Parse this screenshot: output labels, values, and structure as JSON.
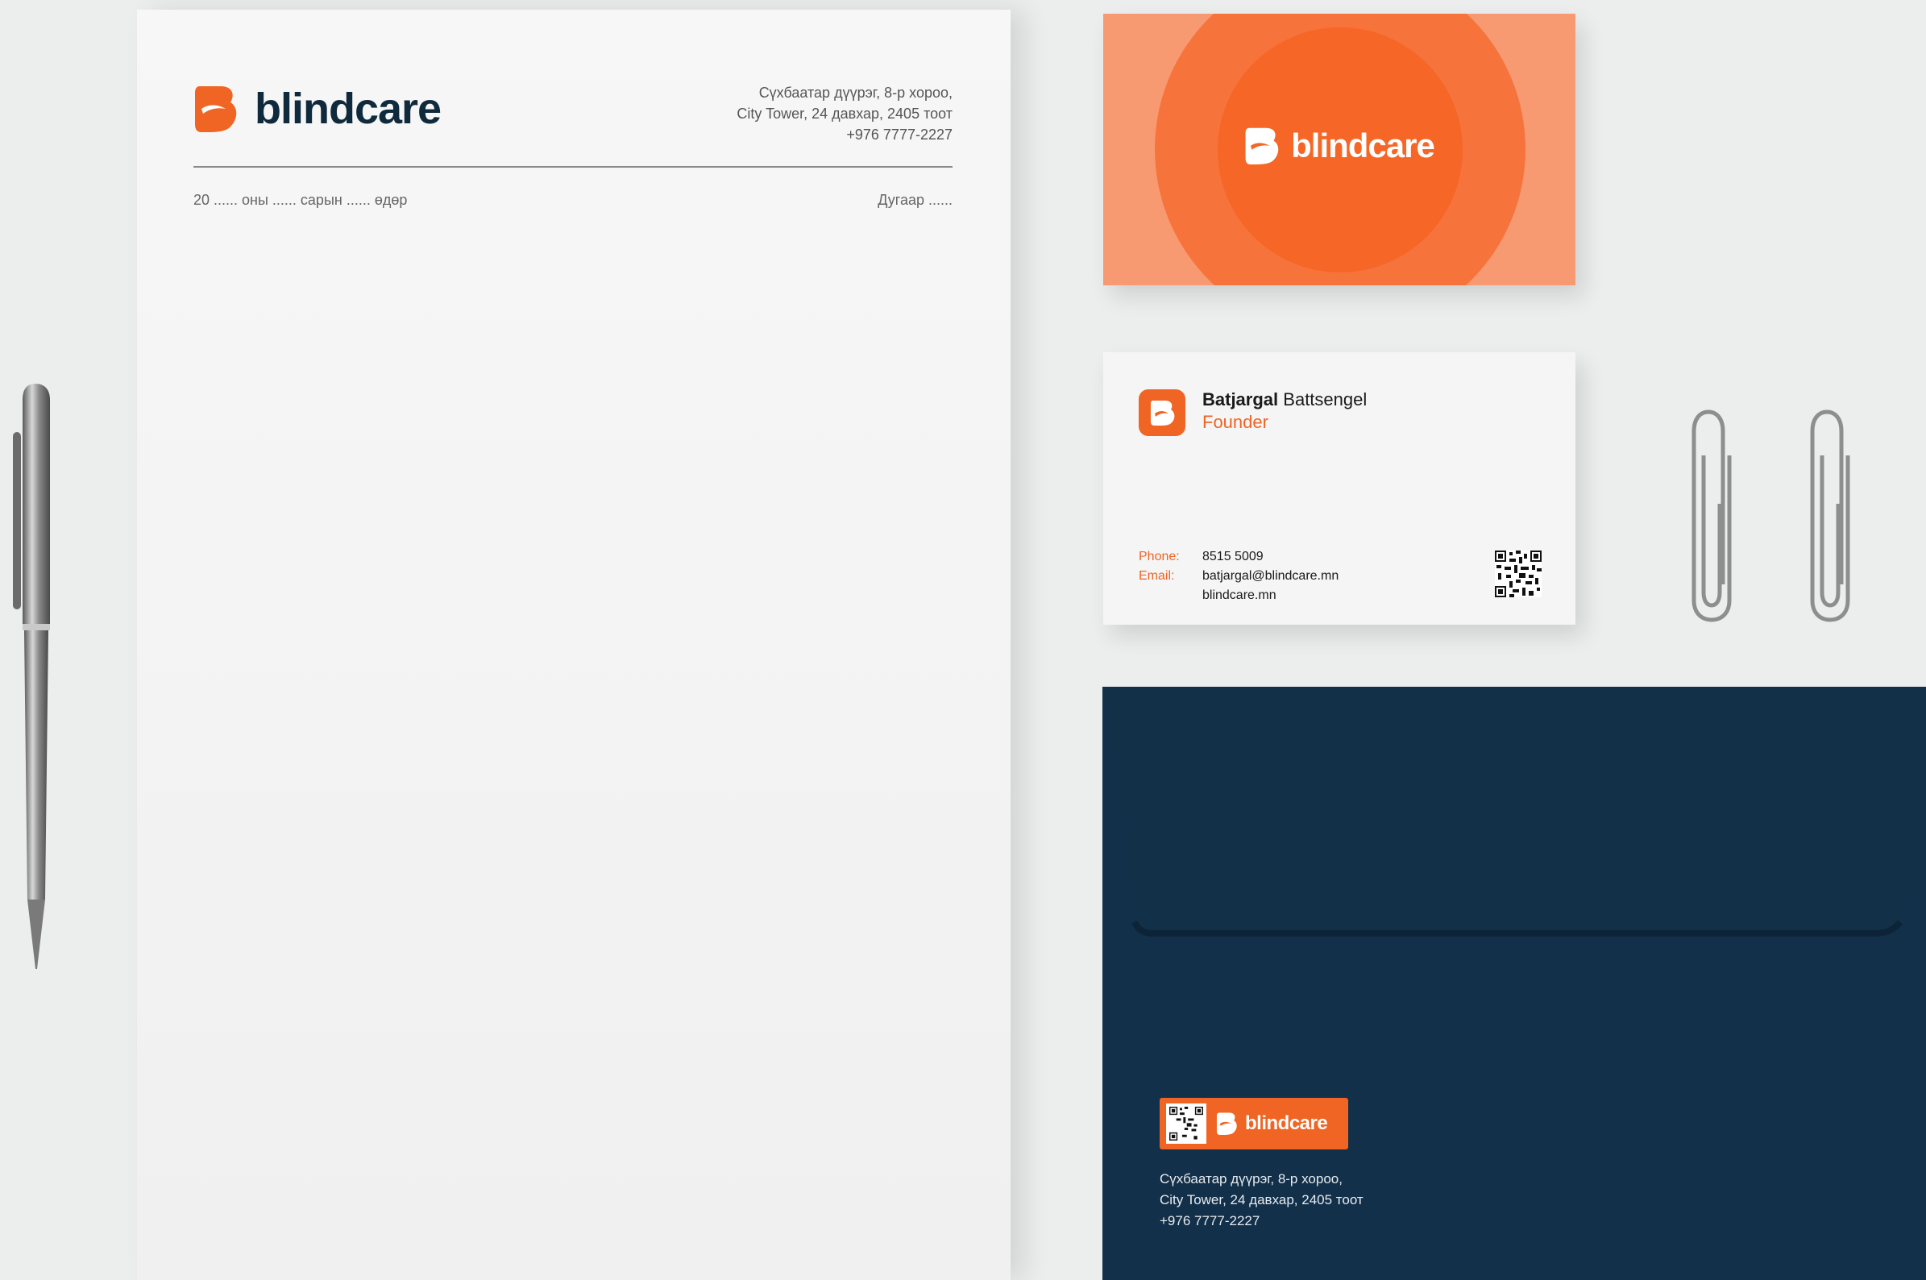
{
  "brand": {
    "name": "blindcare",
    "accent": "#f06424",
    "navy": "#13304a",
    "logo_icon": "brand-b-icon"
  },
  "letterhead": {
    "address_line1": "Сүхбаатар дүүрэг, 8-р хороо,",
    "address_line2": "City Tower, 24 давхар, 2405 тоот",
    "phone": "+976 7777-2227",
    "date_line": "20 ...... оны ...... сарын ...... өдөр",
    "number_line": "Дугаар ......"
  },
  "business_card": {
    "first_name": "Batjargal",
    "last_name": "Battsengel",
    "title": "Founder",
    "phone_label": "Phone:",
    "email_label": "Email:",
    "phone": "8515 5009",
    "email": "batjargal@blindcare.mn",
    "website": "blindcare.mn",
    "qr_icon": "qr-code-icon"
  },
  "envelope": {
    "address_line1": "Сүхбаатар дүүрэг, 8-р хороо,",
    "address_line2": "City Tower, 24 давхар, 2405 тоот",
    "phone": "+976 7777-2227"
  }
}
